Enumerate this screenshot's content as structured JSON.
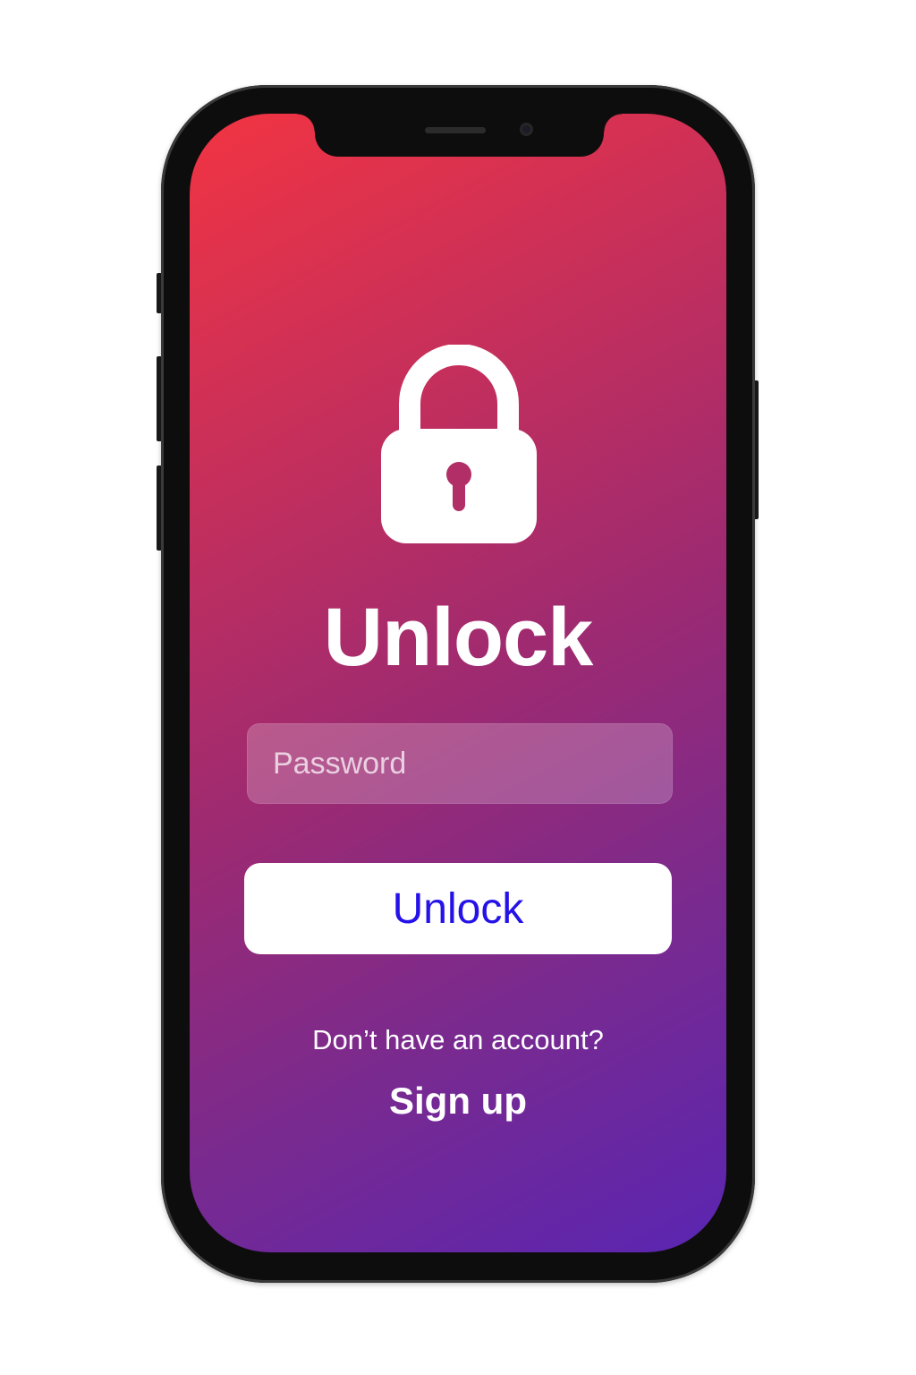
{
  "screen": {
    "lock_icon": "lock-icon",
    "title": "Unlock",
    "password_input": {
      "value": "",
      "placeholder": "Password"
    },
    "unlock_button_label": "Unlock",
    "no_account_prompt": "Don’t have an account?",
    "signup_label": "Sign up"
  },
  "colors": {
    "gradient_start": "#f23442",
    "gradient_end": "#5a25b2",
    "button_text": "#2412e8",
    "button_background": "#ffffff"
  }
}
